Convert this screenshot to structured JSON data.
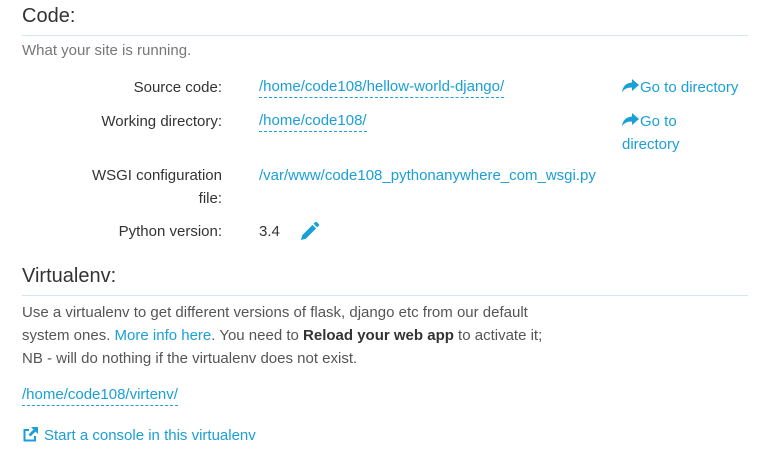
{
  "code": {
    "title": "Code:",
    "subtitle": "What your site is running.",
    "source_code": {
      "label": "Source code:",
      "value": "/home/code108/hellow-world-django/",
      "action": "Go to directory"
    },
    "working_directory": {
      "label": "Working directory:",
      "value": "/home/code108/",
      "action_line1": "Go to",
      "action_line2": "directory"
    },
    "wsgi": {
      "label_line1": "WSGI configuration",
      "label_line2": "file:",
      "value": "/var/www/code108_pythonanywhere_com_wsgi.py"
    },
    "python_version": {
      "label": "Python version:",
      "value": "3.4"
    }
  },
  "virtualenv": {
    "title": "Virtualenv:",
    "para": {
      "text1": "Use a virtualenv to get different versions of flask, django etc from our default system ones. ",
      "link": "More info here",
      "text2": ". You need to ",
      "bold": "Reload your web app",
      "text3": " to activate it; NB - will do nothing if the virtualenv does not exist."
    },
    "path": "/home/code108/virtenv/",
    "console_label": "Start a console in this virtualenv"
  },
  "icons": {
    "go_to": "share-arrow-icon",
    "edit": "pencil-icon",
    "console": "external-link-icon"
  },
  "colors": {
    "link": "#1a9fd6",
    "text": "#333333",
    "muted": "#777777",
    "rule": "#cfe8f3"
  }
}
